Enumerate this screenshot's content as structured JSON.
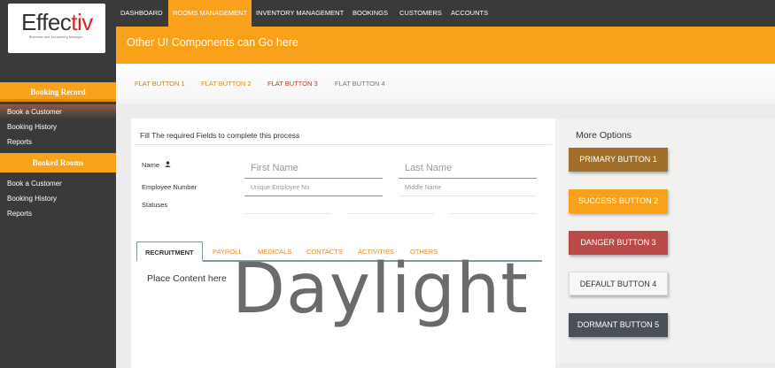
{
  "brand": {
    "logo_main": "Effec",
    "logo_accent": "tiv",
    "tagline": "Business and Accounting Manager"
  },
  "sidebar": {
    "sections": [
      {
        "header": "Booking Record",
        "items": [
          {
            "label": "Book a Customer",
            "active": true
          },
          {
            "label": "Booking History",
            "active": false
          },
          {
            "label": "Reports",
            "active": false
          }
        ]
      },
      {
        "header": "Booked Rooms",
        "items": [
          {
            "label": "Book a Customer",
            "active": false
          },
          {
            "label": "Booking History",
            "active": false
          },
          {
            "label": "Reports",
            "active": false
          }
        ]
      }
    ]
  },
  "topnav": {
    "items": [
      {
        "label": "DASHBOARD",
        "active": false
      },
      {
        "label": "ROOMS MANAGEMENT",
        "active": true
      },
      {
        "label": "INVENTORY MANAGEMENT",
        "active": false
      },
      {
        "label": "BOOKINGS",
        "active": false
      },
      {
        "label": "CUSTOMERS",
        "active": false
      },
      {
        "label": "ACCOUNTS",
        "active": false
      }
    ]
  },
  "banner": {
    "text": "Other UI Components can Go here"
  },
  "flat_buttons": [
    {
      "label": "FLAT BUTTON 1",
      "color": "#b8862c"
    },
    {
      "label": "FLAT BUTTON 2",
      "color": "#e08a1e"
    },
    {
      "label": "FLAT BUTTON 3",
      "color": "#c0392b"
    },
    {
      "label": "FLAT BUTTON 4",
      "color": "#777777"
    }
  ],
  "form": {
    "title": "Fill The required Fields to complete this process",
    "labels": {
      "name": "Name",
      "employee_number": "Employee Number",
      "statuses": "Statuses"
    },
    "placeholders": {
      "first_name": "First Name",
      "last_name": "Last Name",
      "employee_no": "Unique Employee No",
      "middle_name": "Middle Name"
    }
  },
  "tabs": [
    {
      "label": "RECRUITMENT",
      "active": true
    },
    {
      "label": "PAYROLL",
      "active": false
    },
    {
      "label": "MEDICALS",
      "active": false
    },
    {
      "label": "CONTACTS",
      "active": false
    },
    {
      "label": "ACTIVITIES",
      "active": false
    },
    {
      "label": "OTHERS",
      "active": false
    }
  ],
  "tab_content": "Place Content here",
  "watermark": "Daylight",
  "more_options": {
    "title": "More Options",
    "buttons": [
      {
        "label": "PRIMARY BUTTON 1",
        "bg": "#a0702a",
        "fg": "#ffffff"
      },
      {
        "label": "SUCCESS BUTTON 2",
        "bg": "#f9a11b",
        "fg": "#ffffff"
      },
      {
        "label": "DANGER BUTTON 3",
        "bg": "#b94a48",
        "fg": "#ffffff"
      },
      {
        "label": "DEFAULT BUTTON 4",
        "bg": "#f7f7f7",
        "fg": "#333333"
      },
      {
        "label": "DORMANT BUTTON 5",
        "bg": "#4a5058",
        "fg": "#ffffff"
      }
    ]
  },
  "colors": {
    "accent": "#f9a11b",
    "dark": "#3a3a3a",
    "tab_text": "#e08a1e",
    "field_line_active": "#c98a1e"
  }
}
